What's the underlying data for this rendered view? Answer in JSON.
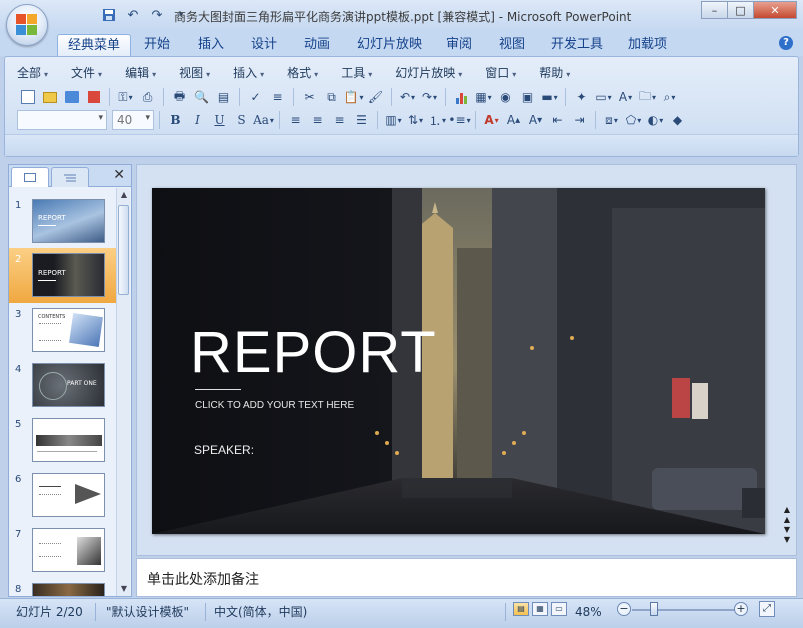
{
  "window": {
    "title": "商务大图封面三角形扁平化商务演讲ppt模板.ppt [兼容模式] - Microsoft PowerPoint"
  },
  "ribbon_tabs": [
    "经典菜单",
    "开始",
    "插入",
    "设计",
    "动画",
    "幻灯片放映",
    "审阅",
    "视图",
    "开发工具",
    "加载项"
  ],
  "classic_menu": [
    "全部",
    "文件",
    "编辑",
    "视图",
    "插入",
    "格式",
    "工具",
    "幻灯片放映",
    "窗口",
    "帮助"
  ],
  "toolbar": {
    "font_name": "",
    "font_size": "40"
  },
  "slides": {
    "numbers": [
      "1",
      "2",
      "3",
      "4",
      "5",
      "6",
      "7",
      "8"
    ],
    "selected_index": 2
  },
  "slide": {
    "title": "REPORT",
    "subtitle": "CLICK TO ADD YOUR TEXT HERE",
    "speaker": "SPEAKER:"
  },
  "thumbs": {
    "t1_title": "REPORT",
    "t2_title": "REPORT",
    "t3_title": "CONTENTS",
    "t4_title": "PART ONE"
  },
  "notes": {
    "placeholder": "单击此处添加备注"
  },
  "status": {
    "slide_counter": "幻灯片 2/20",
    "theme": "\"默认设计模板\"",
    "language": "中文(简体，中国)",
    "zoom": "48%",
    "zoom_fraction": 0.48
  },
  "colors": {
    "accent_selected": "#f0a840",
    "ribbon_bg": "#d5e3f5"
  }
}
